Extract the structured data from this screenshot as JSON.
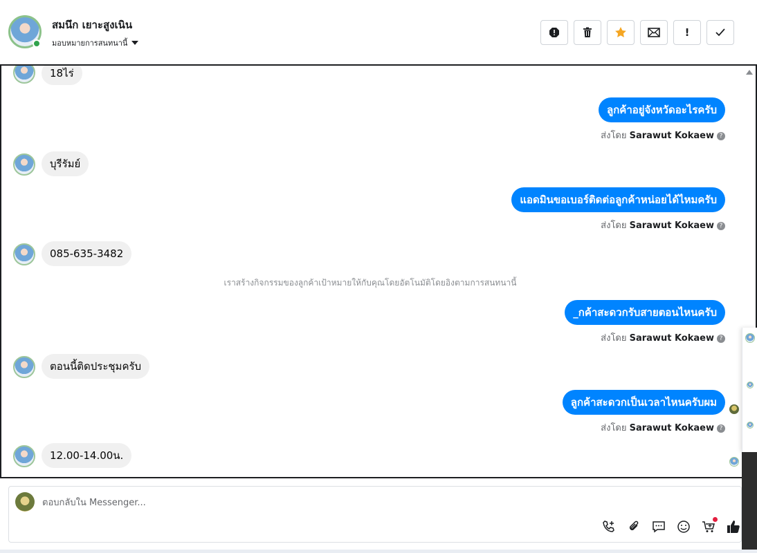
{
  "header": {
    "contact_name": "สมนึก เยาะสูงเนิน",
    "assign_label": "มอบหมายการสนทนานี้",
    "actions": [
      {
        "name": "report-icon",
        "glyph": "!"
      },
      {
        "name": "trash-icon",
        "glyph": "🗑"
      },
      {
        "name": "star-icon",
        "glyph": "★"
      },
      {
        "name": "mail-icon",
        "glyph": "✉"
      },
      {
        "name": "exclaim-icon",
        "glyph": "!"
      },
      {
        "name": "check-icon",
        "glyph": "✓"
      }
    ]
  },
  "messages": {
    "m1": "18ไร่",
    "m2": "ลูกค้าอยู่จังหวัดอะไรครับ",
    "m3": "บุรีรัมย์",
    "m4": "แอดมินขอเบอร์ติดต่อลูกค้าหน่อยได้ไหมครับ",
    "m5": "085-635-3482",
    "m6": "_กค้าสะดวกรับสายตอนไหนครับ",
    "m7": "ตอนนี้ติดประชุมครับ",
    "m8": "ลูกค้าสะดวกเป็นเวลาไหนครับผม",
    "m9": "12.00-14.00น."
  },
  "sent_by": {
    "prefix": "ส่งโดย",
    "agent": "Sarawut Kokaew"
  },
  "system_note": "เราสร้างกิจกรรมของลูกค้าเป้าหมายให้กับคุณโดยอัตโนมัติโดยอิงตามการสนทนานี้",
  "composer": {
    "placeholder": "ตอบกลับใน Messenger...",
    "tools": [
      "call-add-icon",
      "attach-icon",
      "chat-bubble-icon",
      "emoji-icon",
      "cart-icon",
      "like-icon"
    ]
  },
  "colors": {
    "outgoing": "#0084ff",
    "incoming": "#f0f0f0",
    "star": "#f5a623"
  }
}
